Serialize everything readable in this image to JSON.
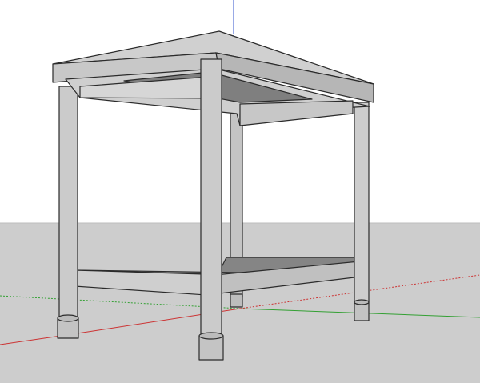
{
  "viewport": {
    "sky_color": "#ffffff",
    "ground_color": "#cdcdcd",
    "horizon_color": "#bdbdbd"
  },
  "axes": {
    "red_axis_color": "#cc3333",
    "green_axis_color": "#33a033",
    "blue_axis_color": "#3355cc"
  },
  "model": {
    "name": "table-with-lower-shelf",
    "edge_color": "#2b2b2b",
    "top_color": "#d0d0d0",
    "side_light_color": "#c6c6c6",
    "side_dark_color": "#a8a8a8",
    "underside_color": "#7f7f7f",
    "leg_color": "#cccccc",
    "shelf_top_color": "#858585",
    "shelf_front_color": "#cfcfcf"
  }
}
